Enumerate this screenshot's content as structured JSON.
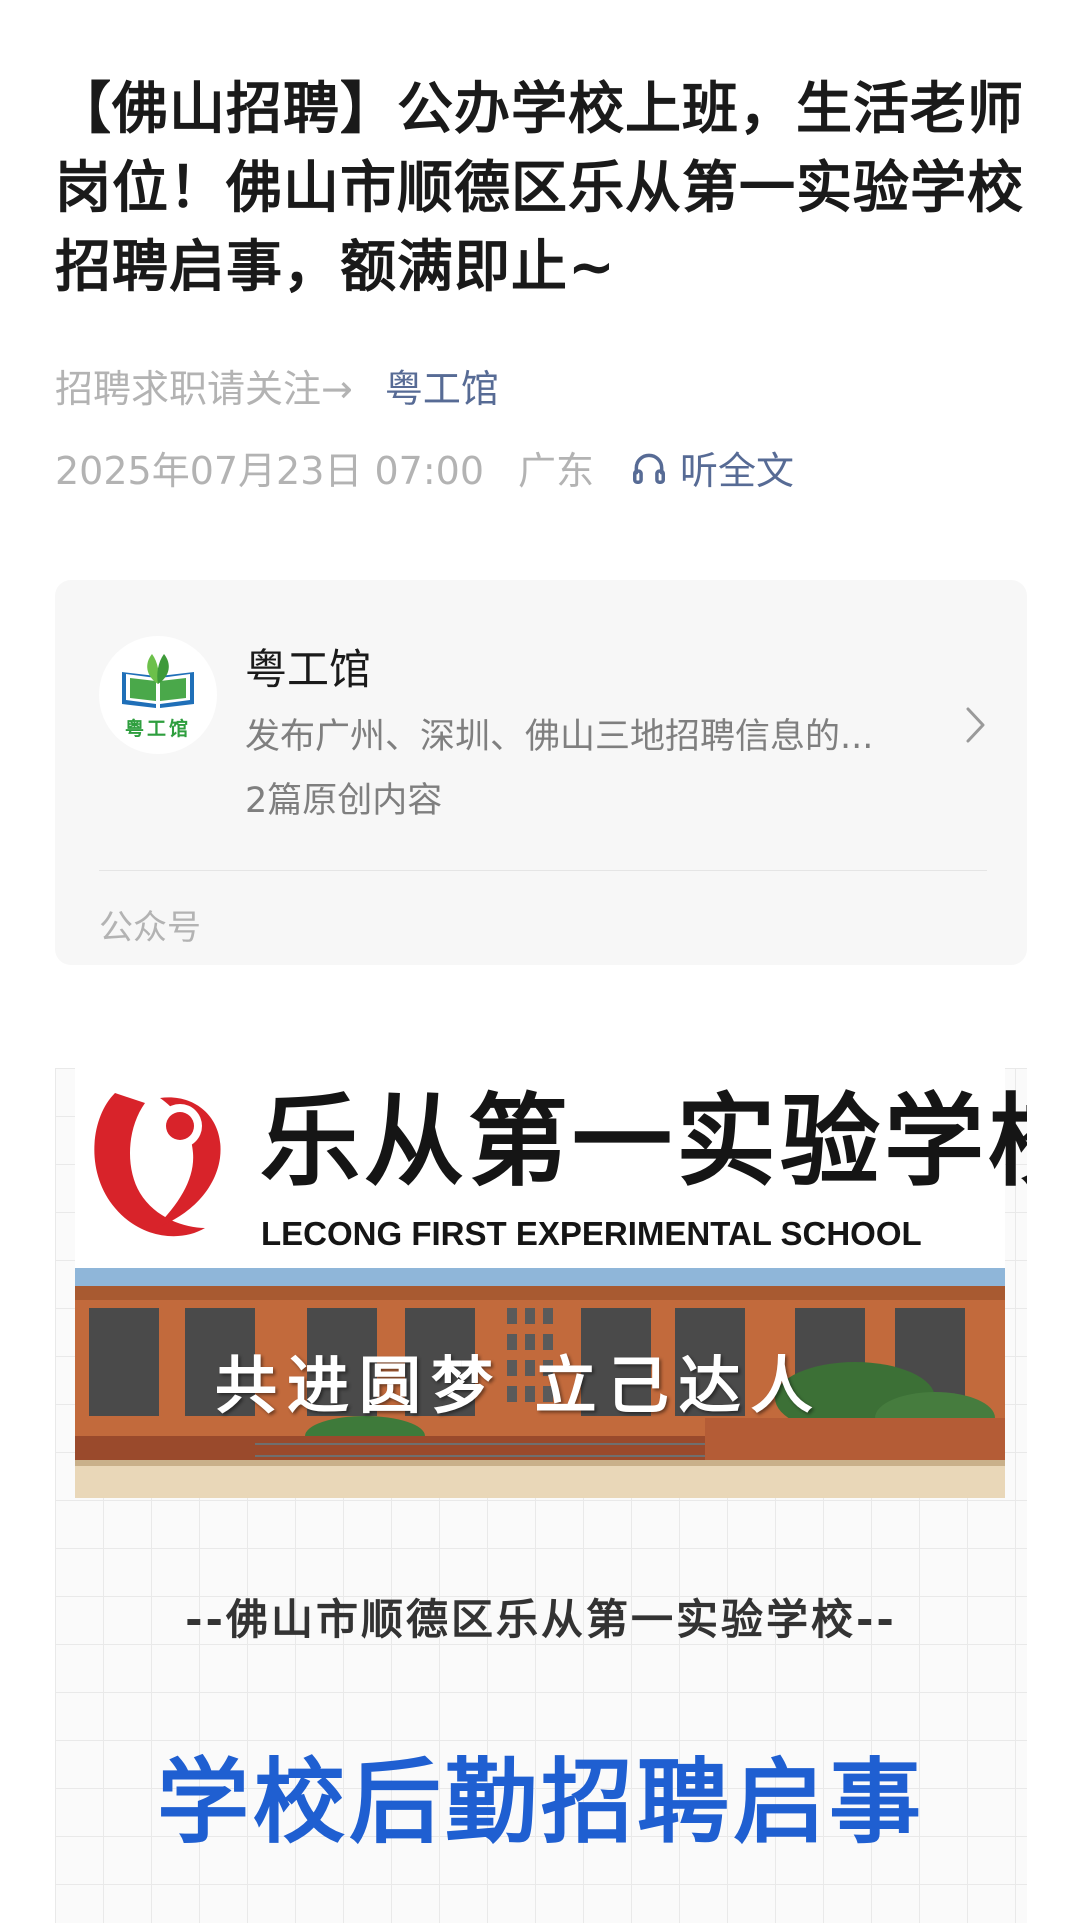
{
  "article": {
    "title": "【佛山招聘】公办学校上班，生活老师岗位！佛山市顺德区乐从第一实验学校招聘启事，额满即止~",
    "follow_prompt": "招聘求职请关注→",
    "account_link": "粤工馆",
    "date": "2025年07月23日 07:00",
    "location": "广东",
    "listen_label": "听全文"
  },
  "account_card": {
    "avatar_text": "粤工馆",
    "name": "粤工馆",
    "description": "发布广州、深圳、佛山三地招聘信息的...",
    "article_count": "2篇原创内容",
    "footer_label": "公众号"
  },
  "poster": {
    "school_name_cn": "乐从第一实验学校",
    "school_name_en": "LECONG FIRST EXPERIMENTAL SCHOOL",
    "slogan": "共进圆梦  立己达人",
    "subtitle": "--佛山市顺德区乐从第一实验学校--",
    "headline": "学校后勤招聘启事"
  },
  "icons": {
    "listen": "headphones-icon",
    "chevron": "chevron-right-icon"
  },
  "colors": {
    "link": "#576b95",
    "meta_text": "#b3b3b3",
    "card_bg": "#f7f7f7",
    "headline_blue": "#1f5fd1",
    "logo_red": "#d8232a",
    "brand_green": "#2e9e3e"
  }
}
